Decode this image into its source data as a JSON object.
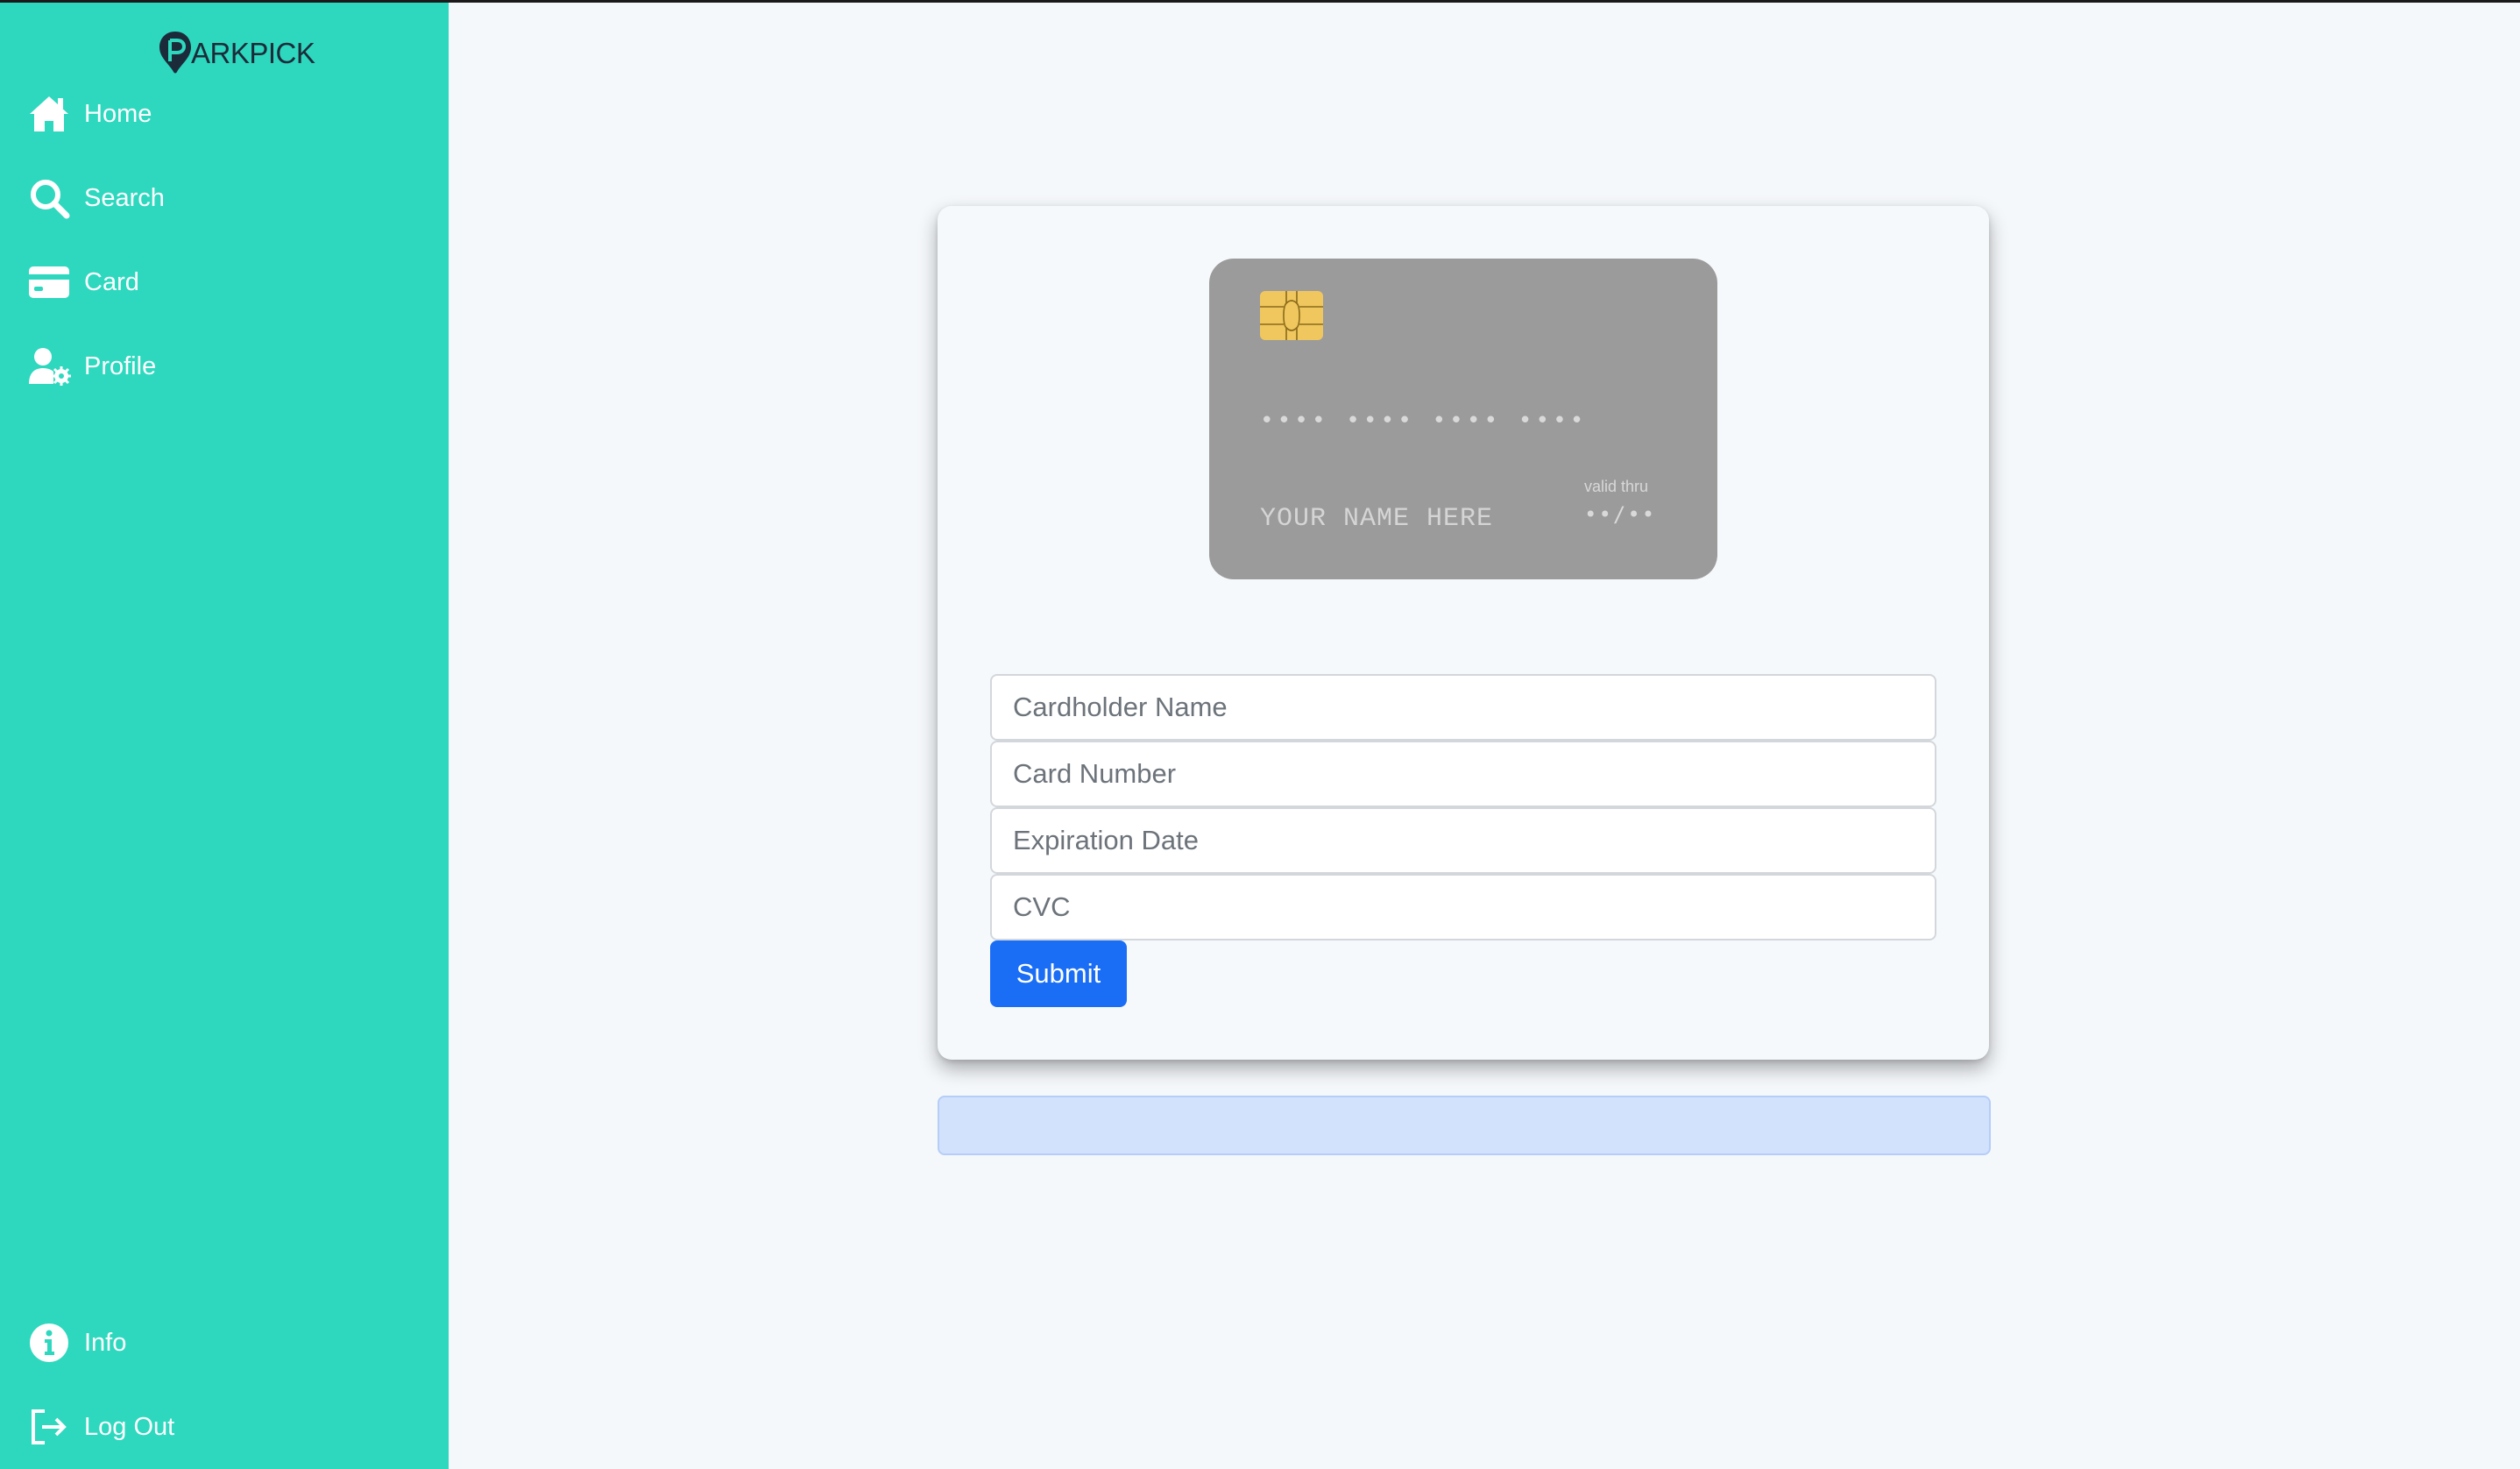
{
  "app": {
    "logo_text": "ARKPICK",
    "logo_initial": "P"
  },
  "sidebar": {
    "items": [
      {
        "label": "Home",
        "icon": "home-icon"
      },
      {
        "label": "Search",
        "icon": "search-icon"
      },
      {
        "label": "Card",
        "icon": "credit-card-icon"
      },
      {
        "label": "Profile",
        "icon": "user-settings-icon"
      }
    ],
    "bottom_items": [
      {
        "label": "Info",
        "icon": "info-icon"
      },
      {
        "label": "Log Out",
        "icon": "logout-icon"
      }
    ]
  },
  "card_preview": {
    "number": "•••• •••• •••• ••••",
    "name": "YOUR NAME HERE",
    "valid_thru_label": "valid thru",
    "expiry": "••/••"
  },
  "form": {
    "name_placeholder": "Cardholder Name",
    "number_placeholder": "Card Number",
    "expiry_placeholder": "Expiration Date",
    "cvc_placeholder": "CVC",
    "submit_label": "Submit"
  },
  "alert": {
    "message": ""
  },
  "colors": {
    "sidebar": "#2dd8be",
    "accent": "#1a6ef5",
    "card": "#9b9b9b",
    "alert": "#d2e2fd"
  }
}
